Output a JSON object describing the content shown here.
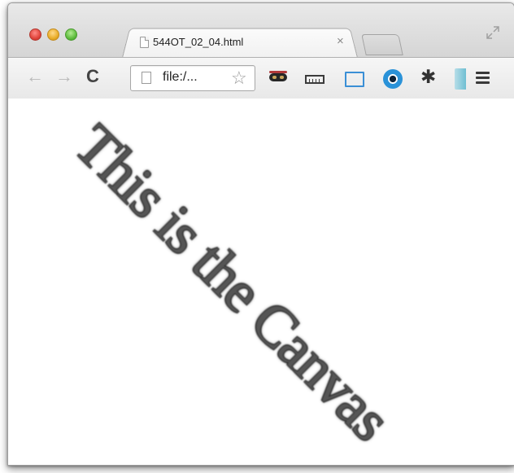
{
  "browser": {
    "tab_title": "544OT_02_04.html",
    "tab_close": "×",
    "address": "file:/...",
    "nav": {
      "back": "←",
      "forward": "→",
      "reload": "C"
    },
    "bookmark_star": "☆",
    "settings_glyph": "✱",
    "extensions": [
      "mask-icon",
      "ruler-icon",
      "frame-icon",
      "eye-icon",
      "gear-icon",
      "tab-icon",
      "menu-icon"
    ]
  },
  "page": {
    "canvas_text": "This is the Canvas"
  }
}
